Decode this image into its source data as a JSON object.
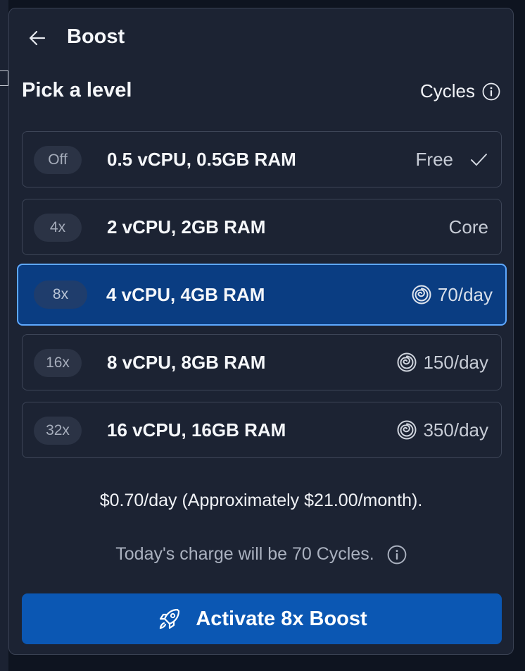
{
  "header": {
    "title": "Boost",
    "back_icon": "arrow-left-icon"
  },
  "section": {
    "heading": "Pick a level",
    "cycles_label": "Cycles"
  },
  "levels": [
    {
      "badge": "Off",
      "spec": "0.5 vCPU, 0.5GB RAM",
      "price": "Free",
      "icon": "check-icon",
      "selected": false
    },
    {
      "badge": "4x",
      "spec": "2 vCPU, 2GB RAM",
      "price": "Core",
      "icon": "",
      "selected": false
    },
    {
      "badge": "8x",
      "spec": "4 vCPU, 4GB RAM",
      "price": "70/day",
      "icon": "spiral-icon",
      "selected": true
    },
    {
      "badge": "16x",
      "spec": "8 vCPU, 8GB RAM",
      "price": "150/day",
      "icon": "spiral-icon",
      "selected": false
    },
    {
      "badge": "32x",
      "spec": "16 vCPU, 16GB RAM",
      "price": "350/day",
      "icon": "spiral-icon",
      "selected": false
    }
  ],
  "summary": "$0.70/day (Approximately $21.00/month).",
  "charge_note": "Today's charge will be 70 Cycles.",
  "activate_button": "Activate 8x Boost",
  "colors": {
    "panel_bg": "#1c2333",
    "selected_bg": "#0a3d82",
    "selected_border": "#5ea8ff",
    "button_bg": "#0b57b3"
  }
}
